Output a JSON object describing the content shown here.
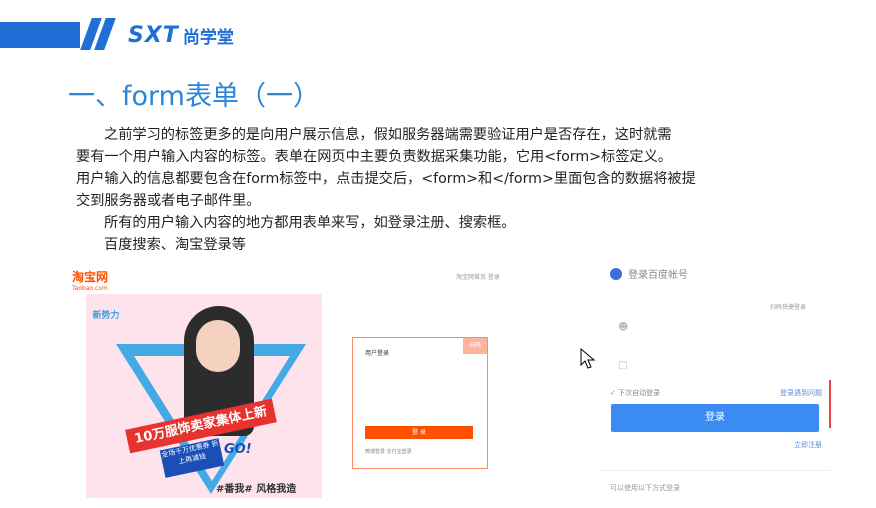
{
  "header": {
    "logo_mark": "SXT",
    "logo_cn": "尚学堂",
    "brand_color": "#1f6fd6"
  },
  "slide": {
    "title": "一、form表单（一）",
    "title_color": "#2a86d8",
    "lines": [
      "之前学习的标签更多的是向用户展示信息，假如服务器端需要验证用户是否存在，这时就需",
      "要有一个用户输入内容的标签。表单在网页中主要负责数据采集功能，它用<form>标签定义。",
      "用户输入的信息都要包含在form标签中，点击提交后，<form>和</form>里面包含的数据将被提",
      "交到服务器或者电子邮件里。",
      "所有的用户输入内容的地方都用表单来写，如登录注册、搜索框。",
      "百度搜索、淘宝登录等"
    ]
  },
  "taobao": {
    "logo": "淘宝网",
    "logo_sub": "Taobao.com",
    "new_label": "新势力",
    "ribbon": "10万服饰卖家集体上新",
    "badge": "全场千万优惠券 折上再减钱",
    "go": "GO!",
    "tag": "#番我# 风格我造",
    "top_line": "淘宝网首页  登录",
    "login_title": "用户登录",
    "login_corner": "扫码",
    "login_button": "登 录",
    "login_footer": "微博登录    支付宝登录"
  },
  "baidu": {
    "head": "登录百度帐号",
    "scan": "扫码快捷登录",
    "username_icon": "user-icon",
    "password_icon": "lock-icon",
    "remember": "下次自动登录",
    "forgot": "登录遇到问题",
    "login_button": "登录",
    "register": "立即注册",
    "other": "可以使用以下方式登录",
    "accent": "#3b8cf2"
  }
}
